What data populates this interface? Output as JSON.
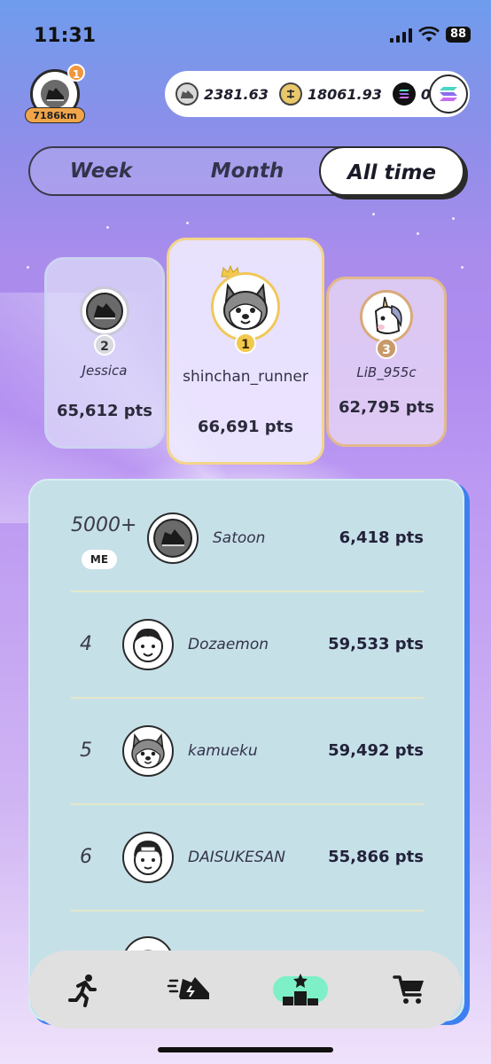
{
  "status_bar": {
    "time": "11:31",
    "battery": "88"
  },
  "profile": {
    "badge_count": "1",
    "distance": "7186km"
  },
  "currencies": [
    {
      "icon": "sneaker-coin-icon",
      "value": "2381.63"
    },
    {
      "icon": "gold-coin-icon",
      "value": "18061.93"
    },
    {
      "icon": "solana-icon",
      "value": "0"
    }
  ],
  "tabs": [
    {
      "label": "Week",
      "active": false
    },
    {
      "label": "Month",
      "active": false
    },
    {
      "label": "All time",
      "active": true
    }
  ],
  "podium": {
    "first": {
      "rank": "1",
      "name": "shinchan_runner",
      "points": "66,691 pts"
    },
    "second": {
      "rank": "2",
      "name": "Jessica",
      "points": "65,612 pts"
    },
    "third": {
      "rank": "3",
      "name": "LiB_955c",
      "points": "62,795 pts"
    }
  },
  "leaderboard": {
    "me": {
      "rank": "5000+",
      "badge": "ME",
      "name": "Satoon",
      "points": "6,418 pts"
    },
    "rows": [
      {
        "rank": "4",
        "name": "Dozaemon",
        "points": "59,533 pts"
      },
      {
        "rank": "5",
        "name": "kamueku",
        "points": "59,492 pts"
      },
      {
        "rank": "6",
        "name": "DAISUKESAN",
        "points": "55,866 pts"
      }
    ]
  },
  "nav": [
    {
      "icon": "runner-icon",
      "active": false
    },
    {
      "icon": "sneaker-icon",
      "active": false
    },
    {
      "icon": "podium-icon",
      "active": true
    },
    {
      "icon": "cart-icon",
      "active": false
    }
  ],
  "colors": {
    "accent_active": "#7df0c8",
    "panel": "#c6e0e8",
    "gold": "#f2d58a"
  }
}
